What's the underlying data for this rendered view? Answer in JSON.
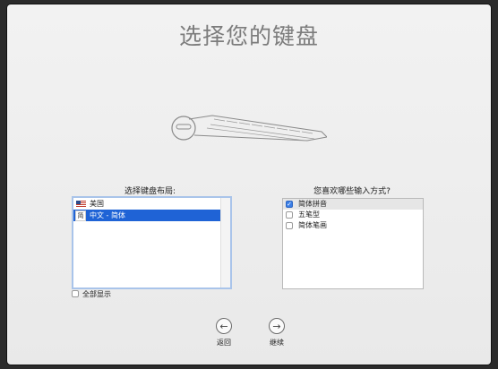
{
  "title": "选择您的键盘",
  "left_section": {
    "label": "选择键盘布局:",
    "items": [
      {
        "label": "美国",
        "icon": "us-flag-icon",
        "selected": false
      },
      {
        "label": "中文 - 简体",
        "icon": "chinese-input-icon",
        "icon_glyph": "简",
        "selected": true
      }
    ]
  },
  "right_section": {
    "label": "您喜欢哪些输入方式?",
    "items": [
      {
        "label": "简体拼音",
        "checked": true
      },
      {
        "label": "五笔型",
        "checked": false
      },
      {
        "label": "简体笔画",
        "checked": false
      }
    ]
  },
  "show_all": {
    "label": "全部显示",
    "checked": false
  },
  "nav": {
    "back_label": "返回",
    "continue_label": "继续"
  },
  "colors": {
    "selection": "#1f63d6",
    "title": "#7c7c7c",
    "checkbox_checked": "#3a7ee6"
  }
}
